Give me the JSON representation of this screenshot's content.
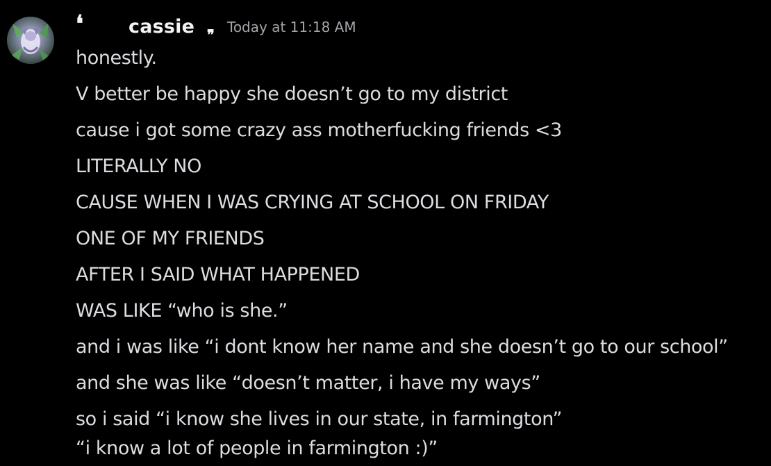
{
  "message": {
    "username": "cassie",
    "timestamp": "Today at 11:18 AM",
    "username_decoration": {
      "left": "❛",
      "right": "❞"
    },
    "lines": [
      "honestly.",
      "V better be happy she doesn’t go to my district",
      "cause i got some crazy ass motherfucking friends <3",
      "LITERALLY NO",
      "CAUSE WHEN I WAS CRYING AT SCHOOL ON FRIDAY",
      "ONE OF MY FRIENDS",
      "AFTER I SAID WHAT HAPPENED",
      "WAS LIKE “who is she.”",
      "and i was like “i dont know her name and she doesn’t go to our school”",
      "and she was like “doesn’t matter, i have my ways”",
      "so i said “i know she lives in our state, in farmington”",
      "“i know a lot of people in farmington :)”"
    ]
  },
  "colors": {
    "background": "#000000",
    "username": "#f2f3f5",
    "message_text": "#dcdde1",
    "timestamp": "#a3a6aa"
  },
  "icons": {
    "avatar": "avatar-image"
  }
}
